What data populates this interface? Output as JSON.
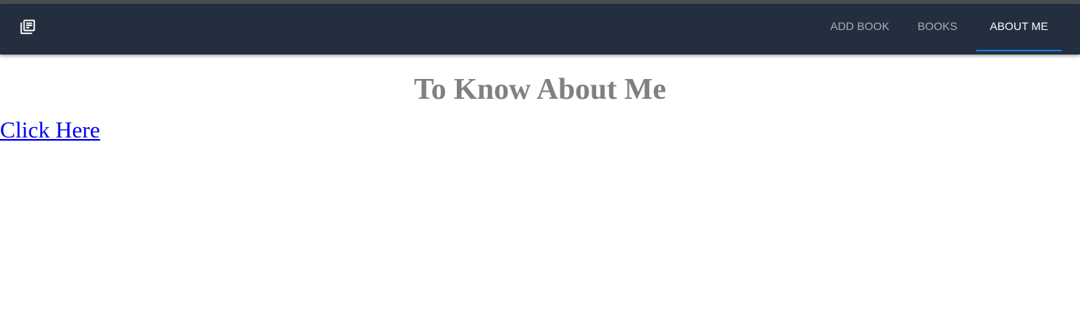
{
  "navbar": {
    "logo_icon": "library-books-icon",
    "background_color": "#232f3e",
    "tabs": [
      {
        "label": "ADD BOOK",
        "active": false
      },
      {
        "label": "BOOKS",
        "active": false
      },
      {
        "label": "ABOUT ME",
        "active": true
      }
    ],
    "active_indicator_color": "#1976d2"
  },
  "main": {
    "title": "To Know About Me",
    "title_color": "#808080",
    "link_text": "Click Here",
    "link_color": "#0000ee"
  }
}
